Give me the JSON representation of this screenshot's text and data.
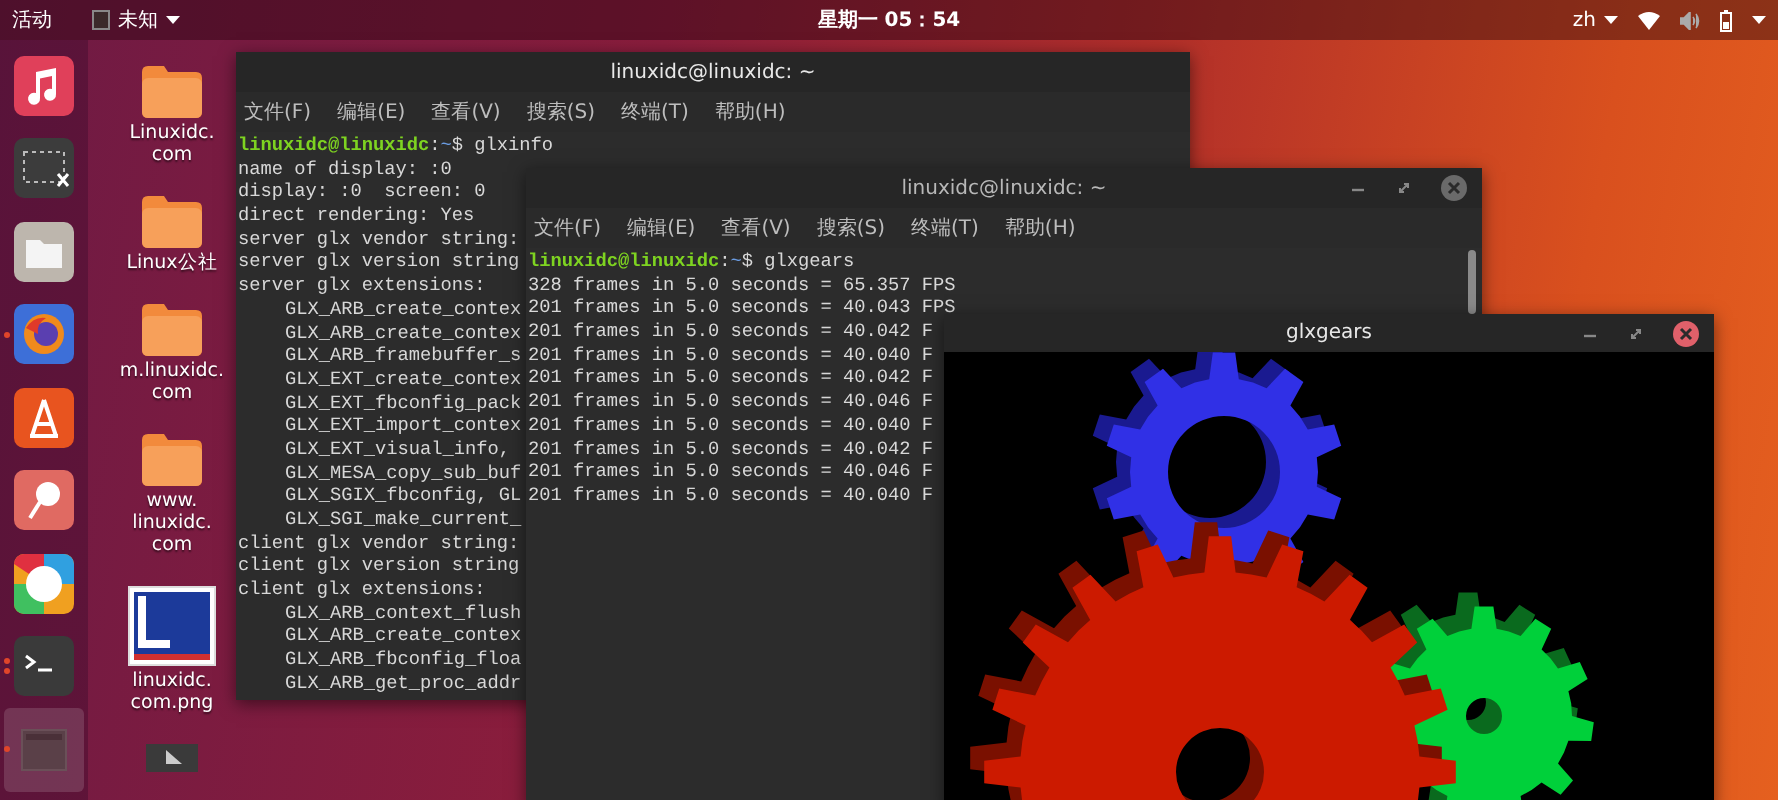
{
  "top_bar": {
    "activities": "活动",
    "app_menu": "未知",
    "clock": "星期一 05：54",
    "input_method": "zh"
  },
  "dock": [
    {
      "kind": "music",
      "running": false,
      "multiple_windows": false,
      "highlighted": false
    },
    {
      "kind": "screenshot",
      "running": false,
      "multiple_windows": false,
      "highlighted": false
    },
    {
      "kind": "files",
      "running": false,
      "multiple_windows": false,
      "highlighted": false
    },
    {
      "kind": "browser",
      "running": true,
      "multiple_windows": false,
      "highlighted": false
    },
    {
      "kind": "software",
      "running": false,
      "multiple_windows": false,
      "highlighted": false
    },
    {
      "kind": "help",
      "running": false,
      "multiple_windows": false,
      "highlighted": false
    },
    {
      "kind": "photos",
      "running": false,
      "multiple_windows": false,
      "highlighted": false
    },
    {
      "kind": "terminal",
      "running": true,
      "multiple_windows": true,
      "highlighted": false
    },
    {
      "kind": "window",
      "running": true,
      "multiple_windows": false,
      "highlighted": true
    }
  ],
  "desktop_icons": [
    {
      "kind": "folder",
      "label_lines": [
        "Linuxidc.",
        "com"
      ]
    },
    {
      "kind": "folder",
      "label_lines": [
        "Linux公社"
      ]
    },
    {
      "kind": "folder",
      "label_lines": [
        "m.linuxidc.",
        "com"
      ]
    },
    {
      "kind": "folder",
      "label_lines": [
        "www.",
        "linuxidc.",
        "com"
      ]
    },
    {
      "kind": "image",
      "label_lines": [
        "linuxidc.",
        "com.png"
      ]
    },
    {
      "kind": "video"
    }
  ],
  "terminal_glxinfo": {
    "title": "linuxidc@linuxidc: ~",
    "menu": [
      "文件(F)",
      "编辑(E)",
      "查看(V)",
      "搜索(S)",
      "终端(T)",
      "帮助(H)"
    ],
    "prompt": {
      "user": "linuxidc@linuxidc",
      "separator": ":",
      "path": "~",
      "command": "$ glxinfo"
    },
    "lines": [
      {
        "text": "name of display: :0"
      },
      {
        "text": "display: :0  screen: 0"
      },
      {
        "text": "direct rendering: Yes"
      },
      {
        "text": "server glx vendor string:"
      },
      {
        "text": "server glx version string"
      },
      {
        "text": "server glx extensions:",
        "children": [
          {
            "text": "GLX_ARB_create_contex"
          },
          {
            "text": "GLX_ARB_create_contex"
          },
          {
            "text": "GLX_ARB_framebuffer_s"
          },
          {
            "text": "GLX_EXT_create_contex"
          },
          {
            "text": "GLX_EXT_fbconfig_pack"
          },
          {
            "text": "GLX_EXT_import_contex"
          },
          {
            "text": "GLX_EXT_visual_info,"
          },
          {
            "text": "GLX_MESA_copy_sub_buf"
          },
          {
            "text": "GLX_SGIX_fbconfig, GL"
          },
          {
            "text": "GLX_SGI_make_current_"
          }
        ]
      },
      {
        "text": "client glx vendor string:"
      },
      {
        "text": "client glx version string"
      },
      {
        "text": "client glx extensions:",
        "children": [
          {
            "text": "GLX_ARB_context_flush"
          },
          {
            "text": "GLX_ARB_create_contex"
          },
          {
            "text": "GLX_ARB_fbconfig_floa"
          },
          {
            "text": "GLX_ARB_get_proc_addr"
          }
        ]
      }
    ]
  },
  "terminal_glxgears": {
    "title": "linuxidc@linuxidc: ~",
    "focused": false,
    "menu": [
      "文件(F)",
      "编辑(E)",
      "查看(V)",
      "搜索(S)",
      "终端(T)",
      "帮助(H)"
    ],
    "prompt": {
      "user": "linuxidc@linuxidc",
      "separator": ":",
      "path": "~",
      "command": "$ glxgears"
    },
    "lines": [
      "328 frames in 5.0 seconds = 65.357 FPS",
      "201 frames in 5.0 seconds = 40.043 FPS",
      "201 frames in 5.0 seconds = 40.042 F",
      "201 frames in 5.0 seconds = 40.040 F",
      "201 frames in 5.0 seconds = 40.042 F",
      "201 frames in 5.0 seconds = 40.046 F",
      "201 frames in 5.0 seconds = 40.040 F",
      "201 frames in 5.0 seconds = 40.042 F",
      "201 frames in 5.0 seconds = 40.046 F",
      "201 frames in 5.0 seconds = 40.040 F"
    ]
  },
  "glxgears_window": {
    "title": "glxgears",
    "focused": true
  }
}
